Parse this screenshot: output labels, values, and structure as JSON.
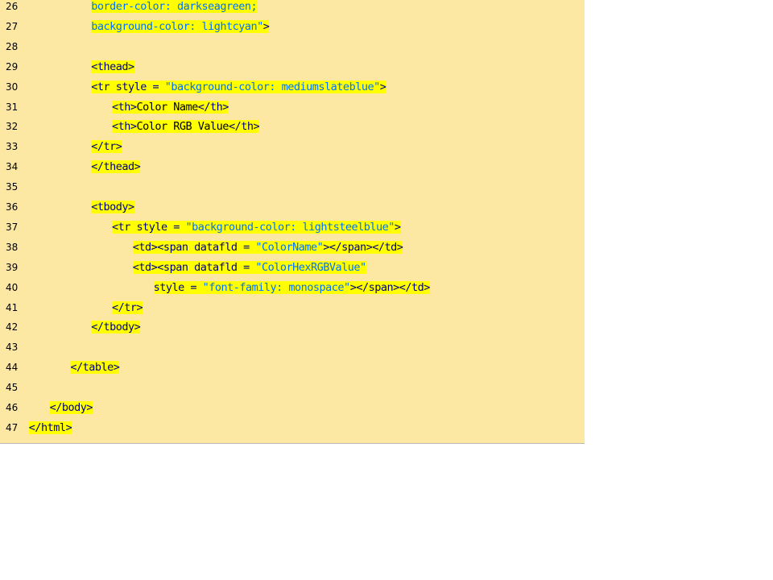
{
  "colors": {
    "panel_background": "#fde8a3",
    "highlight": "#ffff00",
    "markup": "#000080",
    "string": "#0070ff",
    "text": "#000000"
  },
  "code_lines": [
    {
      "number": "26",
      "indent": 4,
      "segments": [
        {
          "text": "border-color: darkseagreen;",
          "kind": "str"
        }
      ]
    },
    {
      "number": "27",
      "indent": 4,
      "segments": [
        {
          "text": "background-color: lightcyan\"",
          "kind": "str"
        },
        {
          "text": ">",
          "kind": "tag"
        }
      ]
    },
    {
      "number": "28",
      "indent": 0,
      "segments": []
    },
    {
      "number": "29",
      "indent": 4,
      "segments": [
        {
          "text": "<thead>",
          "kind": "tag"
        }
      ]
    },
    {
      "number": "30",
      "indent": 4,
      "segments": [
        {
          "text": "<tr style = ",
          "kind": "tag"
        },
        {
          "text": "\"background-color: mediumslateblue\"",
          "kind": "str"
        },
        {
          "text": ">",
          "kind": "tag"
        }
      ]
    },
    {
      "number": "31",
      "indent": 5,
      "segments": [
        {
          "text": "<th>",
          "kind": "tag"
        },
        {
          "text": "Color Name",
          "kind": "txt"
        },
        {
          "text": "</th>",
          "kind": "tag"
        }
      ]
    },
    {
      "number": "32",
      "indent": 5,
      "segments": [
        {
          "text": "<th>",
          "kind": "tag"
        },
        {
          "text": "Color RGB Value",
          "kind": "txt"
        },
        {
          "text": "</th>",
          "kind": "tag"
        }
      ]
    },
    {
      "number": "33",
      "indent": 4,
      "segments": [
        {
          "text": "</tr>",
          "kind": "tag"
        }
      ]
    },
    {
      "number": "34",
      "indent": 4,
      "segments": [
        {
          "text": "</thead>",
          "kind": "tag"
        }
      ]
    },
    {
      "number": "35",
      "indent": 0,
      "segments": []
    },
    {
      "number": "36",
      "indent": 4,
      "segments": [
        {
          "text": "<tbody>",
          "kind": "tag"
        }
      ]
    },
    {
      "number": "37",
      "indent": 5,
      "segments": [
        {
          "text": "<tr style = ",
          "kind": "tag"
        },
        {
          "text": "\"background-color: lightsteelblue\"",
          "kind": "str"
        },
        {
          "text": ">",
          "kind": "tag"
        }
      ]
    },
    {
      "number": "38",
      "indent": 6,
      "segments": [
        {
          "text": "<td><span datafld = ",
          "kind": "tag"
        },
        {
          "text": "\"ColorName\"",
          "kind": "str"
        },
        {
          "text": "></span></td>",
          "kind": "tag"
        }
      ]
    },
    {
      "number": "39",
      "indent": 6,
      "segments": [
        {
          "text": "<td><span datafld = ",
          "kind": "tag"
        },
        {
          "text": "\"ColorHexRGBValue\"",
          "kind": "str"
        }
      ]
    },
    {
      "number": "40",
      "indent": 7,
      "segments": [
        {
          "text": "style = ",
          "kind": "tag"
        },
        {
          "text": "\"font-family: monospace\"",
          "kind": "str"
        },
        {
          "text": "></span></td>",
          "kind": "tag"
        }
      ]
    },
    {
      "number": "41",
      "indent": 5,
      "segments": [
        {
          "text": "</tr>",
          "kind": "tag"
        }
      ]
    },
    {
      "number": "42",
      "indent": 4,
      "segments": [
        {
          "text": "</tbody>",
          "kind": "tag"
        }
      ]
    },
    {
      "number": "43",
      "indent": 0,
      "segments": []
    },
    {
      "number": "44",
      "indent": 3,
      "segments": [
        {
          "text": "</table>",
          "kind": "tag"
        }
      ]
    },
    {
      "number": "45",
      "indent": 0,
      "segments": []
    },
    {
      "number": "46",
      "indent": 2,
      "segments": [
        {
          "text": "</body>",
          "kind": "tag"
        }
      ]
    },
    {
      "number": "47",
      "indent": 1,
      "segments": [
        {
          "text": "</html>",
          "kind": "tag"
        }
      ]
    }
  ]
}
